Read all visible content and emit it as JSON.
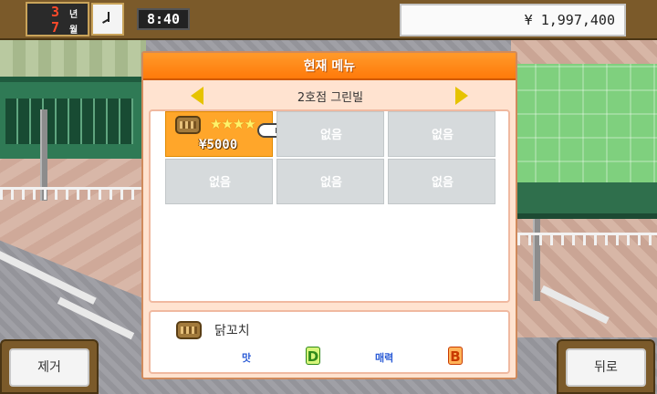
{
  "hud": {
    "year": "3",
    "year_unit": "년",
    "month": "7",
    "month_unit": "월",
    "time": "8:40",
    "money": "¥ 1,997,400"
  },
  "panel": {
    "title": "현재 메뉴",
    "shop_name": "2호점 그린빌",
    "slots": [
      {
        "filled": true,
        "stars": "★★★★",
        "price": "¥5000",
        "icon": "food-skewer-icon"
      },
      {
        "filled": false,
        "label": "없음"
      },
      {
        "filled": false,
        "label": "없음"
      },
      {
        "filled": false,
        "label": "없음"
      },
      {
        "filled": false,
        "label": "없음"
      },
      {
        "filled": false,
        "label": "없음"
      }
    ],
    "info": {
      "item_name": "닭꼬치",
      "taste_label": "맛",
      "taste_grade": "D",
      "charm_label": "매력",
      "charm_grade": "B"
    }
  },
  "buttons": {
    "remove_label": "제거",
    "back_label": "뒤로"
  },
  "colors": {
    "header_orange": "#ff8a1a",
    "filled_slot": "#ffa62a",
    "empty_slot": "#d6dadc",
    "panel_bg": "#ffe3d0",
    "arrow_yellow": "#e6c300"
  }
}
